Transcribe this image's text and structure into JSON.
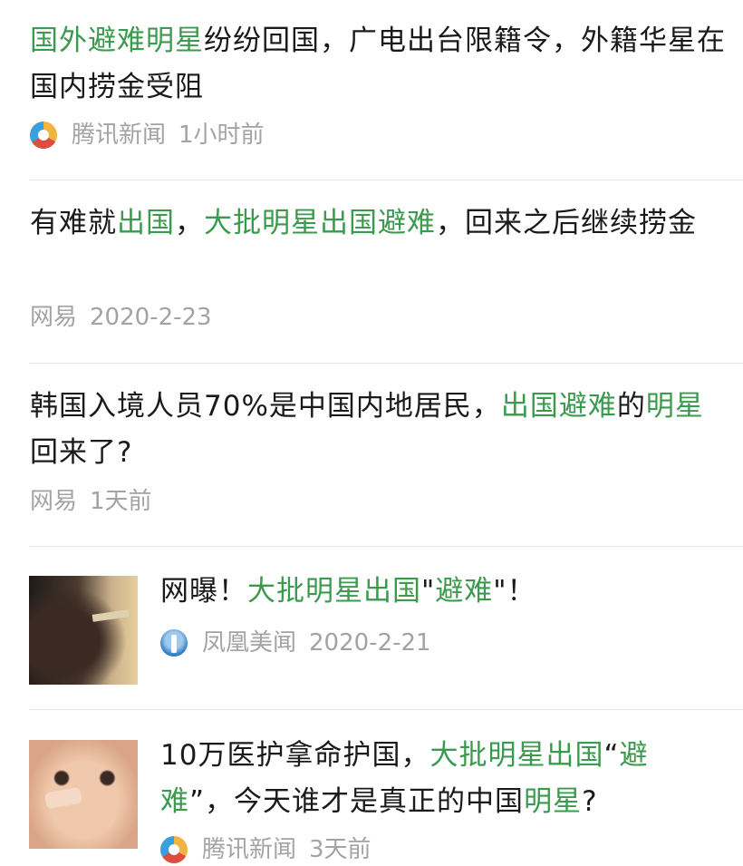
{
  "news_list": [
    {
      "title_parts": [
        {
          "text": "国外避难明星",
          "hl": true
        },
        {
          "text": "纷纷回国，广电出台限籍令，外籍华星在国内捞金受阻",
          "hl": false
        }
      ],
      "source_logo": "tencent-news-logo-icon",
      "source": "腾讯新闻",
      "time": "1小时前"
    },
    {
      "title_parts": [
        {
          "text": "有难就",
          "hl": false
        },
        {
          "text": "出国",
          "hl": true
        },
        {
          "text": "，",
          "hl": false
        },
        {
          "text": "大批明星出国避难",
          "hl": true
        },
        {
          "text": "，回来之后继续捞金",
          "hl": false
        }
      ],
      "source": "网易",
      "time": "2020-2-23"
    },
    {
      "title_parts": [
        {
          "text": "韩国入境人员70%是中国内地居民，",
          "hl": false
        },
        {
          "text": "出国避难",
          "hl": true
        },
        {
          "text": "的",
          "hl": false
        },
        {
          "text": "明星",
          "hl": true
        },
        {
          "text": "回来了?",
          "hl": false
        }
      ],
      "source": "网易",
      "time": "1天前"
    },
    {
      "title_parts": [
        {
          "text": "网曝！",
          "hl": false
        },
        {
          "text": "大批明星出国",
          "hl": true
        },
        {
          "text": "\"",
          "hl": false
        },
        {
          "text": "避难",
          "hl": true
        },
        {
          "text": "\"！",
          "hl": false
        }
      ],
      "source_logo": "ifeng-news-logo-icon",
      "source": "凤凰美闻",
      "time": "2020-2-21",
      "thumbnail": "dark-photo-thumbnail"
    },
    {
      "title_parts": [
        {
          "text": "10万医护拿命护国，",
          "hl": false
        },
        {
          "text": "大批明星出国",
          "hl": true
        },
        {
          "text": "“",
          "hl": false
        },
        {
          "text": "避难",
          "hl": true
        },
        {
          "text": "”，今天谁才是真正的中国",
          "hl": false
        },
        {
          "text": "明星",
          "hl": true
        },
        {
          "text": "?",
          "hl": false
        }
      ],
      "source_logo": "tencent-news-logo-icon",
      "source": "腾讯新闻",
      "time": "3天前",
      "thumbnail": "face-photo-thumbnail"
    }
  ],
  "colors": {
    "highlight": "#3a9a4e",
    "meta_text": "#a3a3a3",
    "title_text": "#1a1a1a",
    "divider": "#e6e6e6"
  }
}
